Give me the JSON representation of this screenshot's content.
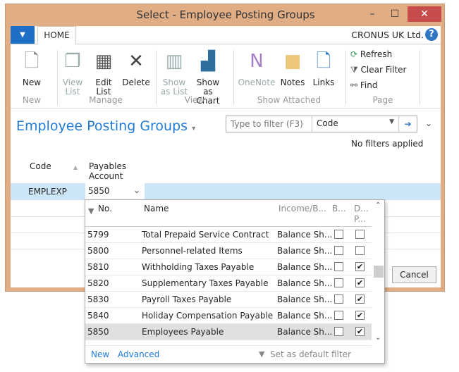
{
  "window": {
    "title": "Select - Employee Posting Groups",
    "minimize": "–",
    "maximize": "☐",
    "close": "✕"
  },
  "ribbon": {
    "app_menu": "▼",
    "tab": "HOME",
    "company": "CRONUS UK Ltd.",
    "help": "?",
    "buttons": {
      "new": "New",
      "view_list": "View List",
      "edit_list": "Edit List",
      "delete": "Delete",
      "show_as_list": "Show as List",
      "show_as_chart": "Show as Chart",
      "onenote": "OneNote",
      "notes": "Notes",
      "links": "Links",
      "refresh": "Refresh",
      "clear_filter": "Clear Filter",
      "find": "Find"
    },
    "groups": {
      "new": "New",
      "manage": "Manage",
      "view": "View",
      "show_attached": "Show Attached",
      "page": "Page"
    }
  },
  "page": {
    "title": "Employee Posting Groups",
    "filter_placeholder": "Type to filter (F3)",
    "filter_field": "Code",
    "filter_status": "No filters applied",
    "columns": [
      "Code",
      "Payables Account"
    ],
    "rows": [
      {
        "code": "EMPLEXP",
        "payables_account": "5850"
      }
    ],
    "cancel": "Cancel"
  },
  "lookup": {
    "columns": [
      "No.",
      "Name",
      "Income/B...",
      "B...",
      "D... P..."
    ],
    "rows": [
      {
        "no": "5799",
        "name": "Total Prepaid Service Contract",
        "type": "Balance Sh...",
        "b": false,
        "d": false
      },
      {
        "no": "5800",
        "name": "Personnel-related Items",
        "type": "Balance Sh...",
        "b": false,
        "d": false
      },
      {
        "no": "5810",
        "name": "Withholding Taxes Payable",
        "type": "Balance Sh...",
        "b": false,
        "d": true
      },
      {
        "no": "5820",
        "name": "Supplementary Taxes Payable",
        "type": "Balance Sh...",
        "b": false,
        "d": true
      },
      {
        "no": "5830",
        "name": "Payroll Taxes Payable",
        "type": "Balance Sh...",
        "b": false,
        "d": true
      },
      {
        "no": "5840",
        "name": "Holiday Compensation Payable",
        "type": "Balance Sh...",
        "b": false,
        "d": true
      },
      {
        "no": "5850",
        "name": "Employees Payable",
        "type": "Balance Sh...",
        "b": false,
        "d": true,
        "selected": true
      }
    ],
    "new": "New",
    "advanced": "Advanced",
    "default_filter": "Set as default filter column"
  }
}
